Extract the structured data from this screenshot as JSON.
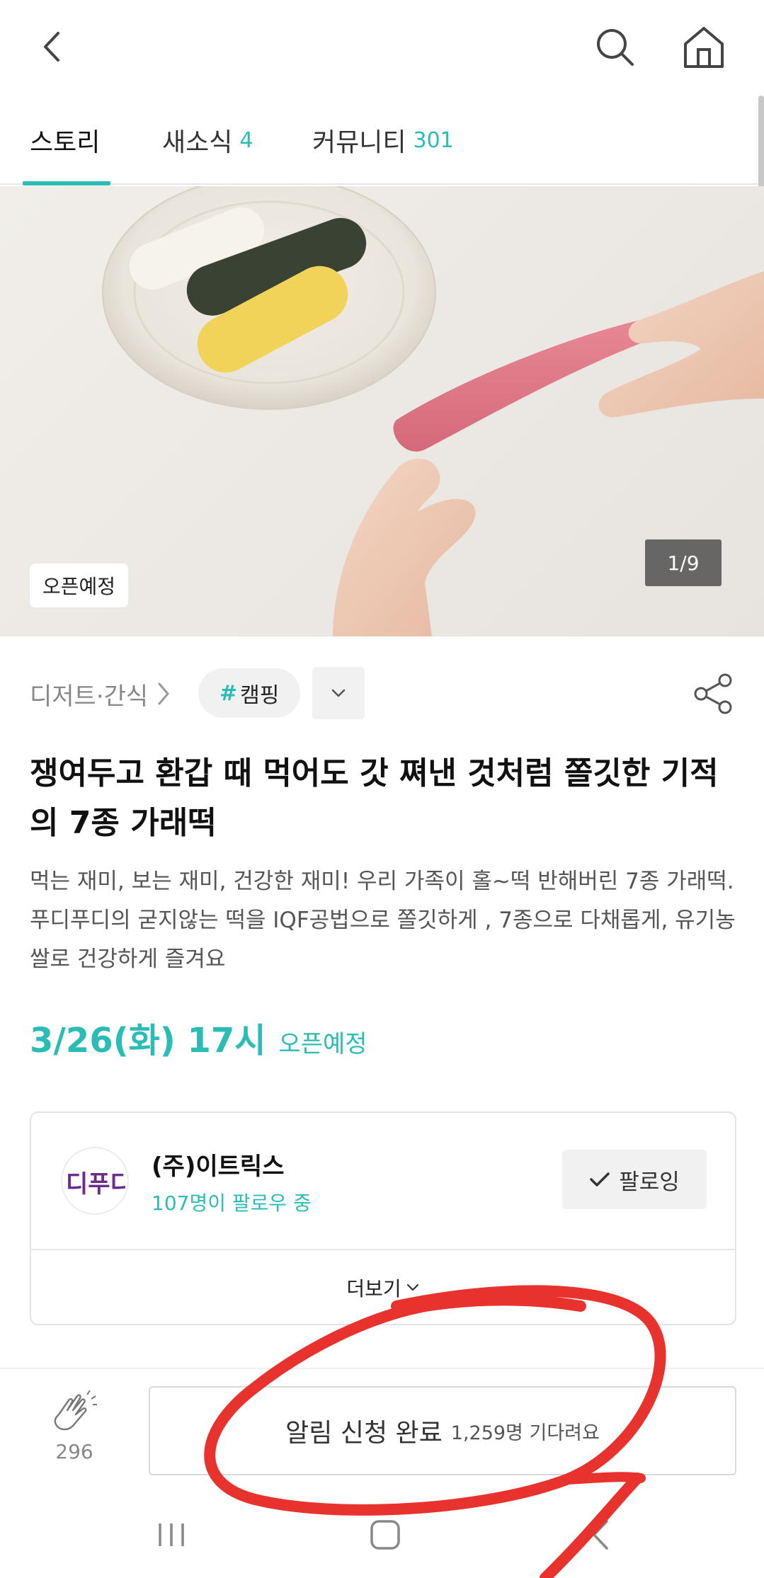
{
  "tabs": [
    {
      "label": "스토리",
      "count": ""
    },
    {
      "label": "새소식",
      "count": "4"
    },
    {
      "label": "커뮤니티",
      "count": "301"
    }
  ],
  "hero": {
    "badge": "오픈예정",
    "pager": "1/9"
  },
  "category": {
    "label": "디저트·간식",
    "tag_hash": "#",
    "tag": "캠핑"
  },
  "title": "쟁여두고 환갑 때 먹어도 갓 쪄낸 것처럼 쫄깃한 기적의 7종 가래떡",
  "description": "먹는 재미, 보는 재미, 건강한 재미! 우리 가족이 홀~떡 반해버린 7종 가래떡. 푸디푸디의 굳지않는 떡을 IQF공법으로 쫄깃하게 , 7종으로 다채롭게, 유기농쌀로 건강하게 즐겨요",
  "open": {
    "date": "3/26(화) 17시",
    "state": "오픈예정"
  },
  "maker": {
    "name": "(주)이트릭스",
    "followers": "107명이 팔로우 중",
    "follow_label": "팔로잉",
    "more_label": "더보기",
    "logo_text": "디푸디"
  },
  "bottom": {
    "clap_count": "296",
    "notify_label": "알림 신청 완료",
    "notify_sub": "1,259명 기다려요"
  },
  "colors": {
    "accent": "#2bbdb5",
    "annotation": "#e8322d"
  }
}
